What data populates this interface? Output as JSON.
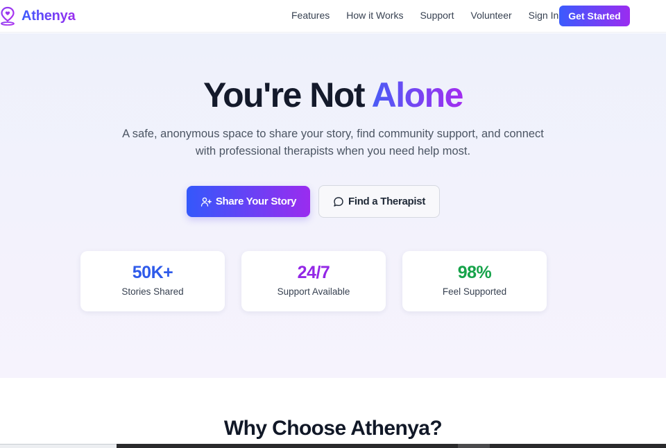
{
  "nav": {
    "brand": "Athenya",
    "links": [
      "Features",
      "How it Works",
      "Support",
      "Volunteer",
      "Sign In"
    ],
    "cta": "Get Started"
  },
  "hero": {
    "title_main": "You're Not ",
    "title_accent": "Alone",
    "subtitle": "A safe, anonymous space to share your story, find community support, and connect with professional therapists when you need help most.",
    "primary_button": "Share Your Story",
    "secondary_button": "Find a Therapist",
    "stats": [
      {
        "value": "50K+",
        "label": "Stories Shared",
        "color": "#2f5bea"
      },
      {
        "value": "24/7",
        "label": "Support Available",
        "color": "#9327e6"
      },
      {
        "value": "98%",
        "label": "Feel Supported",
        "color": "#16a34a"
      }
    ]
  },
  "why": {
    "title": "Why Choose Athenya?"
  },
  "icons": {
    "brand": "location-heart-icon",
    "primary_button": "user-plus-icon",
    "secondary_button": "message-circle-icon"
  },
  "colors": {
    "brand_gradient_start": "#3b5bfd",
    "brand_gradient_end": "#9b2cf0"
  }
}
